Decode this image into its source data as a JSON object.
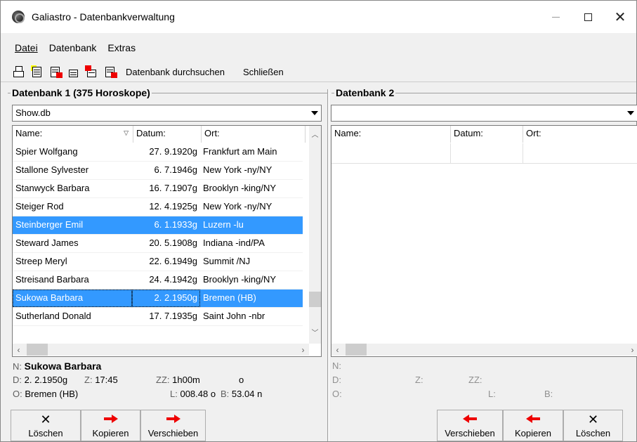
{
  "window": {
    "title": "Galiastro - Datenbankverwaltung",
    "controls": {
      "minimize": "—",
      "maximize": "□",
      "close": "✕"
    }
  },
  "menu": {
    "items": [
      {
        "label": "Datei",
        "accel": "D"
      },
      {
        "label": "Datenbank",
        "accel": "a"
      },
      {
        "label": "Extras",
        "accel": "E"
      }
    ]
  },
  "toolbar": {
    "icons": [
      "print-icon",
      "open-db-icon",
      "copy-db-icon",
      "import-icon",
      "export-icon",
      "save-db-icon"
    ],
    "search_label": "Datenbank durchsuchen",
    "close_label": "Schließen"
  },
  "left": {
    "title": "Datenbank 1 (375 Horoskope)",
    "db_selected": "Show.db",
    "columns": {
      "name": "Name:",
      "date": "Datum:",
      "place": "Ort:"
    },
    "rows": [
      {
        "name": "Spier Wolfgang",
        "date": "27. 9.1920g",
        "place": "Frankfurt am Main",
        "selected": false
      },
      {
        "name": "Stallone Sylvester",
        "date": "6. 7.1946g",
        "place": "New York -ny/NY",
        "selected": false
      },
      {
        "name": "Stanwyck Barbara",
        "date": "16. 7.1907g",
        "place": "Brooklyn -king/NY",
        "selected": false
      },
      {
        "name": "Steiger Rod",
        "date": "12. 4.1925g",
        "place": "New York -ny/NY",
        "selected": false
      },
      {
        "name": "Steinberger Emil",
        "date": "6. 1.1933g",
        "place": "Luzern -lu",
        "selected": true
      },
      {
        "name": "Steward James",
        "date": "20. 5.1908g",
        "place": "Indiana -ind/PA",
        "selected": false
      },
      {
        "name": "Streep Meryl",
        "date": "22. 6.1949g",
        "place": "Summit /NJ",
        "selected": false
      },
      {
        "name": "Streisand Barbara",
        "date": "24. 4.1942g",
        "place": "Brooklyn -king/NY",
        "selected": false
      },
      {
        "name": "Sukowa Barbara",
        "date": "2. 2.1950g",
        "place": "Bremen (HB)",
        "selected": true,
        "focused": true
      },
      {
        "name": "Sutherland Donald",
        "date": "17. 7.1935g",
        "place": "Saint John -nbr",
        "selected": false
      }
    ],
    "info": {
      "n_label": "N:",
      "n_value": "Sukowa Barbara",
      "d_label": "D:",
      "d_value": "2. 2.1950g",
      "z_label": "Z:",
      "z_value": "17:45",
      "zz_label": "ZZ:",
      "zz_value": "1h00m",
      "zz_dir": "o",
      "o_label": "O:",
      "o_value": "Bremen (HB)",
      "l_label": "L:",
      "l_value": "008.48 o",
      "b_label": "B:",
      "b_value": "53.04 n"
    },
    "buttons": {
      "delete": "Löschen",
      "copy": "Kopieren",
      "move": "Verschieben"
    }
  },
  "right": {
    "title": "Datenbank 2",
    "db_selected": "",
    "columns": {
      "name": "Name:",
      "date": "Datum:",
      "place": "Ort:"
    },
    "info": {
      "n_label": "N:",
      "d_label": "D:",
      "z_label": "Z:",
      "zz_label": "ZZ:",
      "o_label": "O:",
      "l_label": "L:",
      "b_label": "B:"
    },
    "buttons": {
      "move": "Verschieben",
      "copy": "Kopieren",
      "delete": "Löschen"
    }
  },
  "colors": {
    "selection": "#3399ff",
    "arrow": "#e00000"
  }
}
